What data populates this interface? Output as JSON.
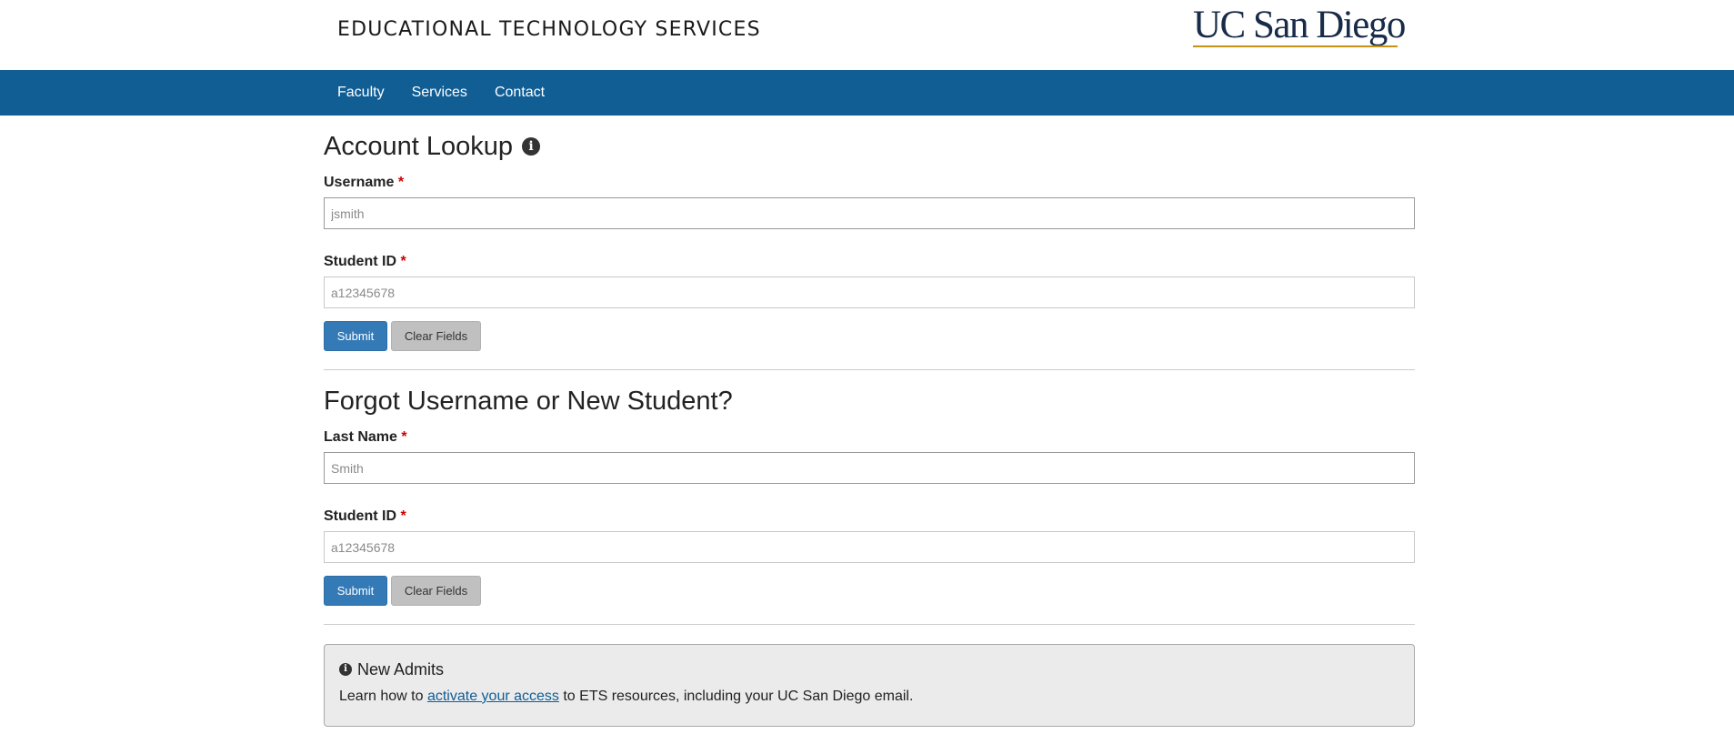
{
  "header": {
    "site_title": "EDUCATIONAL TECHNOLOGY SERVICES",
    "logo_text": "UC San Diego"
  },
  "nav": {
    "items": [
      {
        "label": "Faculty"
      },
      {
        "label": "Services"
      },
      {
        "label": "Contact"
      }
    ]
  },
  "account_lookup": {
    "title": "Account Lookup",
    "username": {
      "label": "Username",
      "required_mark": "*",
      "placeholder": "jsmith",
      "value": ""
    },
    "student_id": {
      "label": "Student ID",
      "required_mark": "*",
      "placeholder": "a12345678",
      "value": ""
    },
    "submit_label": "Submit",
    "clear_label": "Clear Fields"
  },
  "forgot": {
    "title": "Forgot Username or New Student?",
    "last_name": {
      "label": "Last Name",
      "required_mark": "*",
      "placeholder": "Smith",
      "value": ""
    },
    "student_id": {
      "label": "Student ID",
      "required_mark": "*",
      "placeholder": "a12345678",
      "value": ""
    },
    "submit_label": "Submit",
    "clear_label": "Clear Fields"
  },
  "new_admits": {
    "title": "New Admits",
    "text_before": "Learn how to ",
    "link_text": "activate your access",
    "text_after": " to ETS resources, including your UC San Diego email."
  },
  "icons": {
    "info": "info-circle-icon"
  },
  "colors": {
    "nav_bg": "#115e95",
    "primary_button": "#337ab7",
    "secondary_button": "#c0c0c0",
    "required": "#cc0000",
    "logo_navy": "#182b49",
    "logo_gold": "#c69214"
  }
}
